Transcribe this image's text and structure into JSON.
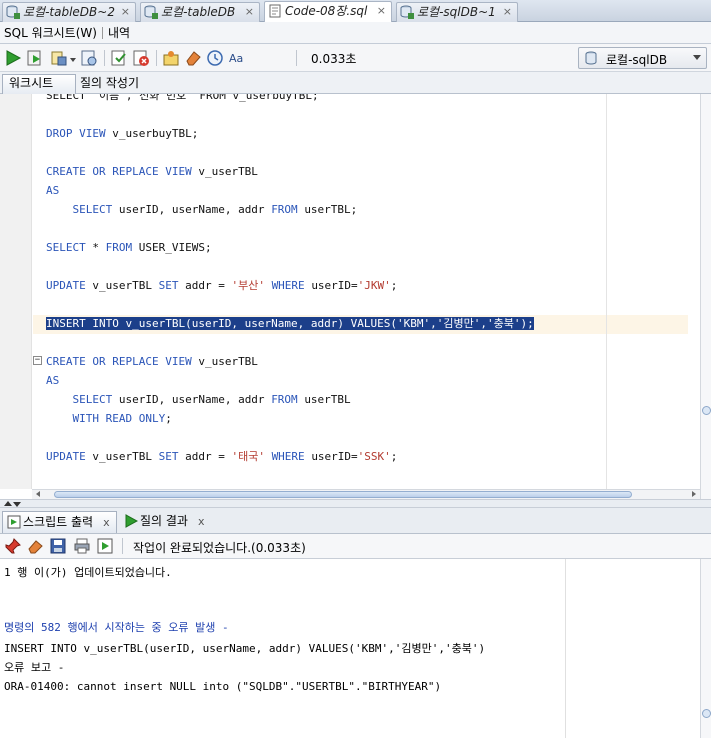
{
  "doc_tabs": [
    {
      "label": "로컬-tableDB~2"
    },
    {
      "label": "로컬-tableDB"
    },
    {
      "label": "Code-08장.sql"
    },
    {
      "label": "로컬-sqlDB~1"
    }
  ],
  "worksheet_tabs": {
    "sql_worksheet": "SQL 워크시트(W)",
    "history": "내역"
  },
  "toolbar": {
    "elapsed": "0.033초",
    "connection": "로컬-sqlDB"
  },
  "sub_tabs": {
    "worksheet": "워크시트",
    "query_builder": "질의 작성기"
  },
  "code_lines": [
    {
      "segments": [
        {
          "t": "SELECT  이름 , 전화 번호  FROM v_userbuyTBL;",
          "c": "plain"
        }
      ]
    },
    {
      "segments": [
        {
          "t": "DROP VIEW ",
          "c": "kw"
        },
        {
          "t": "v_userbuyTBL;",
          "c": "plain"
        }
      ]
    },
    {
      "segments": [
        {
          "t": "CREATE OR REPLACE VIEW ",
          "c": "kw"
        },
        {
          "t": "v_userTBL",
          "c": "plain"
        }
      ]
    },
    {
      "segments": [
        {
          "t": "AS",
          "c": "kw"
        }
      ]
    },
    {
      "segments": [
        {
          "t": "    SELECT ",
          "c": "kw"
        },
        {
          "t": "userID, userName, addr ",
          "c": "plain"
        },
        {
          "t": "FROM ",
          "c": "kw"
        },
        {
          "t": "userTBL;",
          "c": "plain"
        }
      ]
    },
    {
      "segments": [
        {
          "t": "SELECT ",
          "c": "kw"
        },
        {
          "t": "* ",
          "c": "plain"
        },
        {
          "t": "FROM ",
          "c": "kw"
        },
        {
          "t": "USER_VIEWS;",
          "c": "plain"
        }
      ]
    },
    {
      "segments": [
        {
          "t": "UPDATE ",
          "c": "kw"
        },
        {
          "t": "v_userTBL ",
          "c": "plain"
        },
        {
          "t": "SET ",
          "c": "kw"
        },
        {
          "t": "addr = ",
          "c": "plain"
        },
        {
          "t": "'부산' ",
          "c": "str"
        },
        {
          "t": "WHERE ",
          "c": "kw"
        },
        {
          "t": "userID=",
          "c": "plain"
        },
        {
          "t": "'JKW'",
          "c": "str"
        },
        {
          "t": ";",
          "c": "plain"
        }
      ]
    },
    {
      "segments": [
        {
          "t": "INSERT INTO v_userTBL(userID, userName, addr) VALUES('KBM','김병만','충북');",
          "c": "sel"
        }
      ]
    },
    {
      "segments": [
        {
          "t": "CREATE OR REPLACE VIEW ",
          "c": "kw"
        },
        {
          "t": "v_userTBL",
          "c": "plain"
        }
      ]
    },
    {
      "segments": [
        {
          "t": "AS",
          "c": "kw"
        }
      ]
    },
    {
      "segments": [
        {
          "t": "    SELECT ",
          "c": "kw"
        },
        {
          "t": "userID, userName, addr ",
          "c": "plain"
        },
        {
          "t": "FROM ",
          "c": "kw"
        },
        {
          "t": "userTBL",
          "c": "plain"
        }
      ]
    },
    {
      "segments": [
        {
          "t": "    WITH READ ONLY",
          "c": "kw"
        },
        {
          "t": ";",
          "c": "plain"
        }
      ]
    },
    {
      "segments": [
        {
          "t": "UPDATE ",
          "c": "kw"
        },
        {
          "t": "v_userTBL ",
          "c": "plain"
        },
        {
          "t": "SET ",
          "c": "kw"
        },
        {
          "t": "addr = ",
          "c": "plain"
        },
        {
          "t": "'태국' ",
          "c": "str"
        },
        {
          "t": "WHERE ",
          "c": "kw"
        },
        {
          "t": "userID=",
          "c": "plain"
        },
        {
          "t": "'SSK'",
          "c": "str"
        },
        {
          "t": ";",
          "c": "plain"
        }
      ]
    }
  ],
  "output_tabs": {
    "script_output": "스크립트 출력",
    "query_result": "질의 결과"
  },
  "output_toolbar": {
    "status": "작업이 완료되었습니다.(0.033초)"
  },
  "output_lines": [
    {
      "text": "1 행 이(가) 업데이트되었습니다.",
      "style": "plain"
    },
    {
      "text": "명령의 582 행에서 시작하는 중 오류 발생 -",
      "style": "blue"
    },
    {
      "text": "INSERT INTO v_userTBL(userID, userName, addr) VALUES('KBM','김병만','충북')",
      "style": "plain"
    },
    {
      "text": "오류 보고 -",
      "style": "plain"
    },
    {
      "text": "ORA-01400: cannot insert NULL into (\"SQLDB\".\"USERTBL\".\"BIRTHYEAR\")",
      "style": "plain"
    }
  ],
  "colors": {
    "keyword": "#2b55b8",
    "string": "#b33a2f",
    "selection": "#1c3f8a",
    "error_heading": "#1d3fae"
  }
}
